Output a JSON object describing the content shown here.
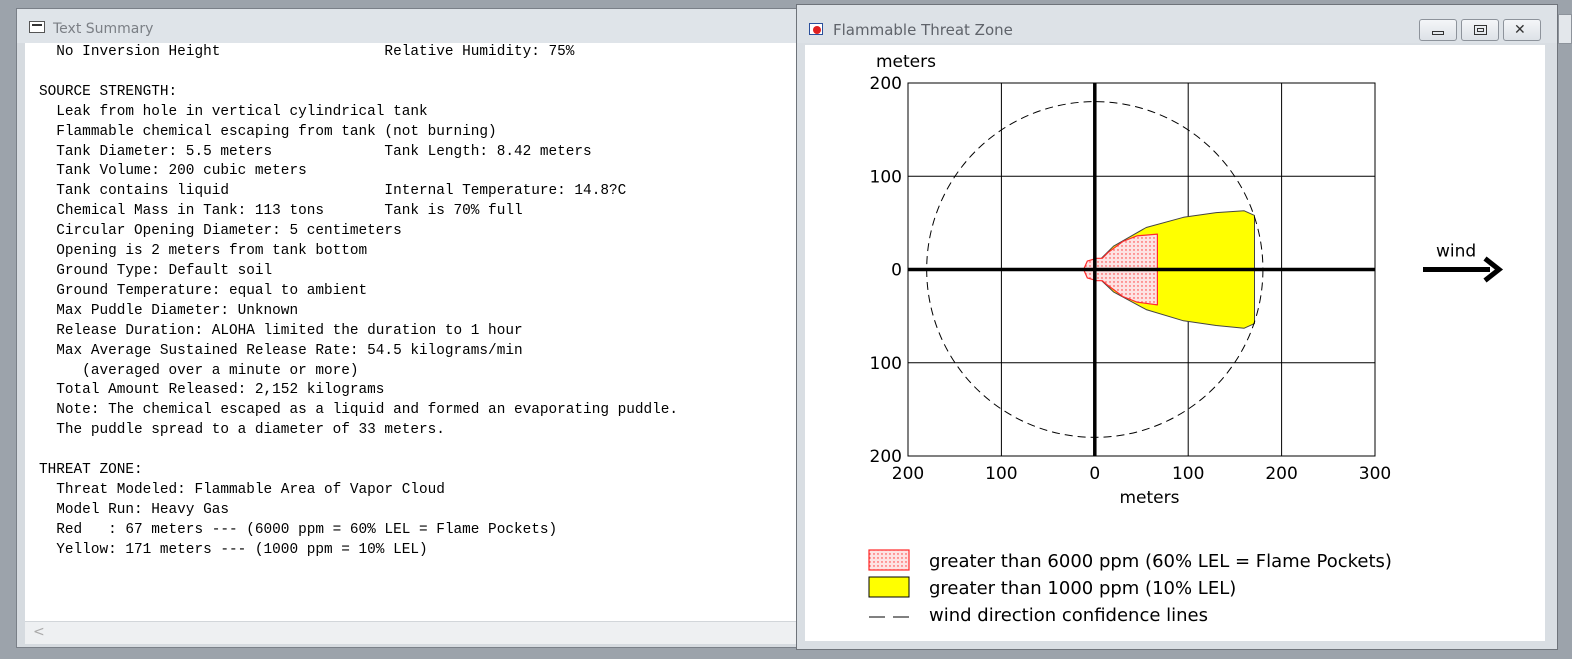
{
  "text_summary": {
    "title": "Text Summary",
    "lines": [
      "  No Inversion Height                   Relative Humidity: 75%",
      "",
      "SOURCE STRENGTH:",
      "  Leak from hole in vertical cylindrical tank",
      "  Flammable chemical escaping from tank (not burning)",
      "  Tank Diameter: 5.5 meters             Tank Length: 8.42 meters",
      "  Tank Volume: 200 cubic meters",
      "  Tank contains liquid                  Internal Temperature: 14.8?C",
      "  Chemical Mass in Tank: 113 tons       Tank is 70% full",
      "  Circular Opening Diameter: 5 centimeters",
      "  Opening is 2 meters from tank bottom",
      "  Ground Type: Default soil",
      "  Ground Temperature: equal to ambient",
      "  Max Puddle Diameter: Unknown",
      "  Release Duration: ALOHA limited the duration to 1 hour",
      "  Max Average Sustained Release Rate: 54.5 kilograms/min",
      "     (averaged over a minute or more)",
      "  Total Amount Released: 2,152 kilograms",
      "  Note: The chemical escaped as a liquid and formed an evaporating puddle.",
      "  The puddle spread to a diameter of 33 meters.",
      "",
      "THREAT ZONE:",
      "  Threat Modeled: Flammable Area of Vapor Cloud",
      "  Model Run: Heavy Gas",
      "  Red   : 67 meters --- (6000 ppm = 60% LEL = Flame Pockets)",
      "  Yellow: 171 meters --- (1000 ppm = 10% LEL)"
    ],
    "scroll_left_glyph": "<"
  },
  "threat_zone": {
    "title": "Flammable Threat Zone",
    "window_buttons": {
      "minimize_glyph": "",
      "maximize_glyph": "",
      "close_glyph": "✕"
    },
    "wind_label": "wind",
    "legend": [
      {
        "label": "greater than 6000 ppm (60% LEL = Flame Pockets)",
        "swatch": "red-dotted"
      },
      {
        "label": "greater than 1000 ppm (10% LEL)",
        "swatch": "yellow"
      },
      {
        "label": "wind direction confidence lines",
        "swatch": "dash"
      }
    ],
    "colors": {
      "red_zone": "#ff2a2a",
      "red_fill": "#fde3e3",
      "yellow_zone": "#ffff00",
      "grid": "#000000"
    }
  },
  "chart_data": {
    "type": "area",
    "x_label": "meters",
    "y_label": "meters",
    "x_ticks": [
      -200,
      -100,
      0,
      100,
      200,
      300
    ],
    "x_tick_labels": [
      "200",
      "100",
      "0",
      "100",
      "200",
      "300"
    ],
    "y_ticks": [
      200,
      100,
      0,
      -100,
      -200
    ],
    "y_tick_labels": [
      "200",
      "100",
      "0",
      "100",
      "200"
    ],
    "xlim": [
      -200,
      300
    ],
    "ylim": [
      -200,
      200
    ],
    "grid": true,
    "legend_placement": "bottom",
    "confidence_circle_radius": 180,
    "zones": [
      {
        "name": "Yellow",
        "level": "1000 ppm (10% LEL)",
        "max_distance_m": 171,
        "outline": [
          [
            0,
            5
          ],
          [
            20,
            25
          ],
          [
            55,
            45
          ],
          [
            95,
            56
          ],
          [
            130,
            61
          ],
          [
            160,
            63
          ],
          [
            171,
            58
          ],
          [
            171,
            0
          ],
          [
            171,
            -58
          ],
          [
            160,
            -63
          ],
          [
            130,
            -60
          ],
          [
            95,
            -55
          ],
          [
            55,
            -43
          ],
          [
            20,
            -24
          ],
          [
            0,
            -5
          ]
        ]
      },
      {
        "name": "Red",
        "level": "6000 ppm (60% LEL = Flame Pockets)",
        "max_distance_m": 67,
        "outline": [
          [
            -12,
            0
          ],
          [
            -8,
            9
          ],
          [
            2,
            12
          ],
          [
            8,
            12
          ],
          [
            14,
            18
          ],
          [
            30,
            30
          ],
          [
            45,
            36
          ],
          [
            67,
            38
          ],
          [
            67,
            0
          ],
          [
            67,
            -38
          ],
          [
            45,
            -35
          ],
          [
            30,
            -29
          ],
          [
            14,
            -17
          ],
          [
            8,
            -12
          ],
          [
            2,
            -12
          ],
          [
            -8,
            -9
          ]
        ]
      }
    ]
  }
}
